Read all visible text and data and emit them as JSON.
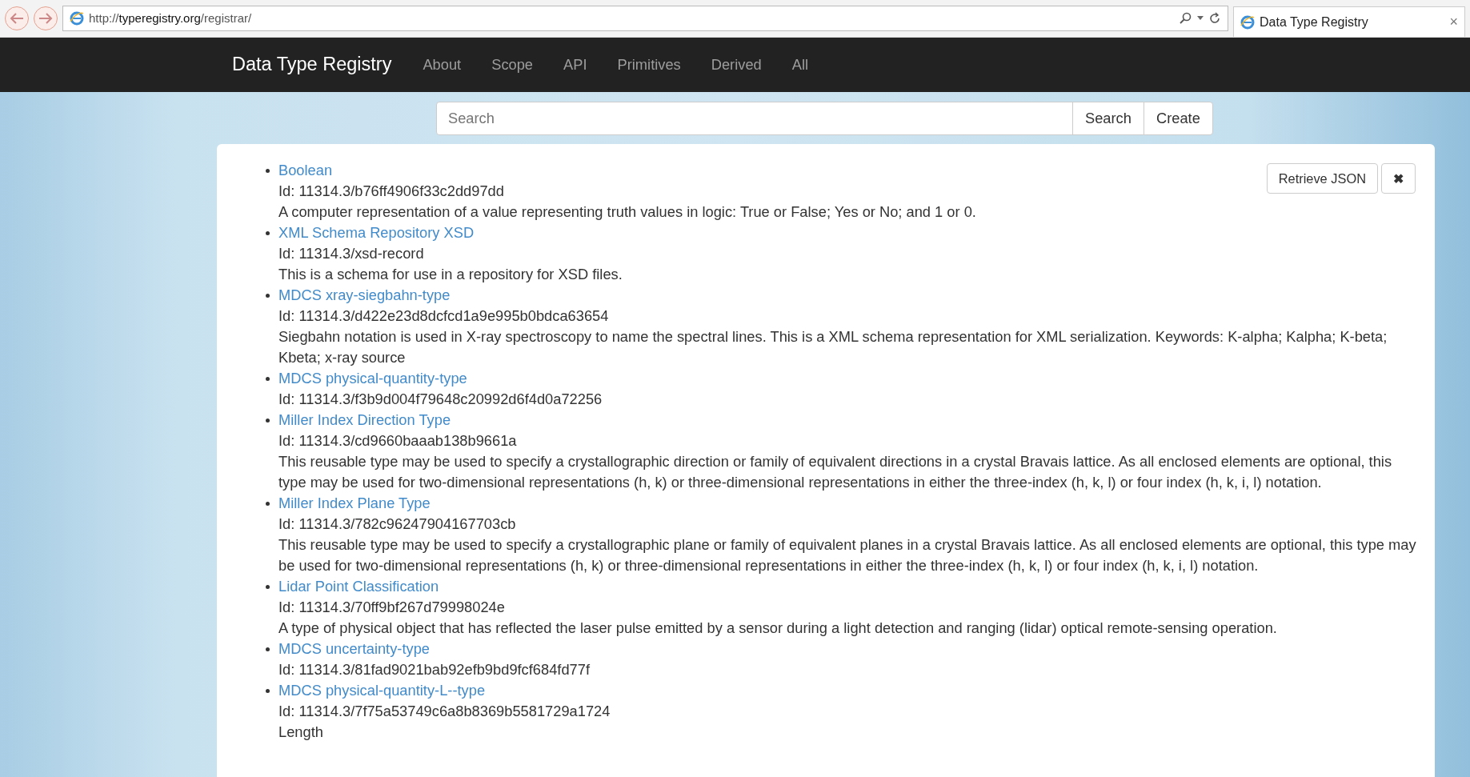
{
  "browser": {
    "url": "http://**typeregistry.org**/registrar/",
    "tab_title": "Data Type Registry",
    "tab_close": "×"
  },
  "navbar": {
    "brand": "Data Type Registry",
    "links": [
      "About",
      "Scope",
      "API",
      "Primitives",
      "Derived",
      "All"
    ]
  },
  "search": {
    "placeholder": "Search",
    "buttons": [
      "Search",
      "Create"
    ]
  },
  "panel": {
    "retrieve_button": "Retrieve JSON",
    "close_button": "✖"
  },
  "items": [
    {
      "name": "Boolean",
      "id": "Id: 11314.3/b76ff4906f33c2dd97dd",
      "description": "A computer representation of a value representing truth values in logic: True or False; Yes or No; and 1 or 0."
    },
    {
      "name": "XML Schema Repository XSD",
      "id": "Id: 11314.3/xsd-record",
      "description": "This is a schema for use in a repository for XSD files."
    },
    {
      "name": "MDCS xray-siegbahn-type",
      "id": "Id: 11314.3/d422e23d8dcfcd1a9e995b0bdca63654",
      "description": "Siegbahn notation is used in X-ray spectroscopy to name the spectral lines. This is a XML schema representation for XML serialization. Keywords: K-alpha; Kalpha; K-beta; Kbeta; x-ray source"
    },
    {
      "name": "MDCS physical-quantity-type",
      "id": "Id: 11314.3/f3b9d004f79648c20992d6f4d0a72256"
    },
    {
      "name": "Miller Index Direction Type",
      "id": "Id: 11314.3/cd9660baaab138b9661a",
      "description": "This reusable type may be used to specify a crystallographic direction or family of equivalent directions in a crystal Bravais lattice. As all enclosed elements are optional, this type may be used for two-dimensional representations (h, k) or three-dimensional representations in either the three-index (h, k, l) or four index (h, k, i, l) notation."
    },
    {
      "name": "Miller Index Plane Type",
      "id": "Id: 11314.3/782c96247904167703cb",
      "description": "This reusable type may be used to specify a crystallographic plane or family of equivalent planes in a crystal Bravais lattice. As all enclosed elements are optional, this type may be used for two-dimensional representations (h, k) or three-dimensional representations in either the three-index (h, k, l) or four index (h, k, i, l) notation."
    },
    {
      "name": "Lidar Point Classification",
      "id": "Id: 11314.3/70ff9bf267d79998024e",
      "description": "A type of physical object that has reflected the laser pulse emitted by a sensor during a light detection and ranging (lidar) optical remote-sensing operation."
    },
    {
      "name": "MDCS uncertainty-type",
      "id": "Id: 11314.3/81fad9021bab92efb9bd9fcf684fd77f"
    },
    {
      "name": "MDCS physical-quantity-L--type",
      "id": "Id: 11314.3/7f75a53749c6a8b8369b5581729a1724",
      "description": "Length"
    }
  ]
}
